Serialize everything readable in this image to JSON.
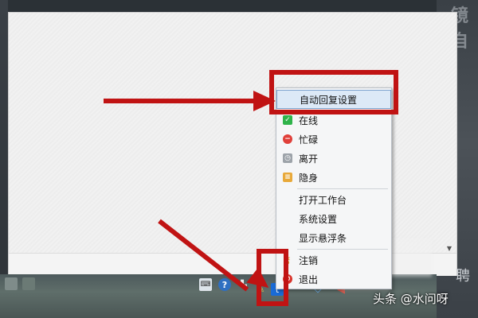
{
  "background": {
    "right_text": "镜自",
    "recruit_text": "聘"
  },
  "context_menu": {
    "items": [
      {
        "label": "自动回复设置",
        "icon": "none",
        "highlighted": true
      },
      {
        "label": "在线",
        "icon": "check-status-icon",
        "color": "#2fb34a"
      },
      {
        "label": "忙碌",
        "icon": "busy-status-icon",
        "color": "#e0403a"
      },
      {
        "label": "离开",
        "icon": "away-clock-icon",
        "color": "#9da3a9"
      },
      {
        "label": "隐身",
        "icon": "invisible-status-icon",
        "color": "#e8a93a"
      },
      {
        "label": "打开工作台",
        "icon": "none"
      },
      {
        "label": "系统设置",
        "icon": "none"
      },
      {
        "label": "显示悬浮条",
        "icon": "none"
      },
      {
        "label": "注销",
        "icon": "key-icon",
        "color": "#d4a326"
      },
      {
        "label": "退出",
        "icon": "exit-icon",
        "color": "#d9342b"
      }
    ]
  },
  "tray": {
    "help_glyph": "?",
    "keyboard_glyph": "⌨",
    "qq_glyph": "t"
  },
  "watermark": "头条 @水问呀",
  "colors": {
    "annotation_red": "#c01313",
    "menu_highlight": "#dce9f7"
  }
}
